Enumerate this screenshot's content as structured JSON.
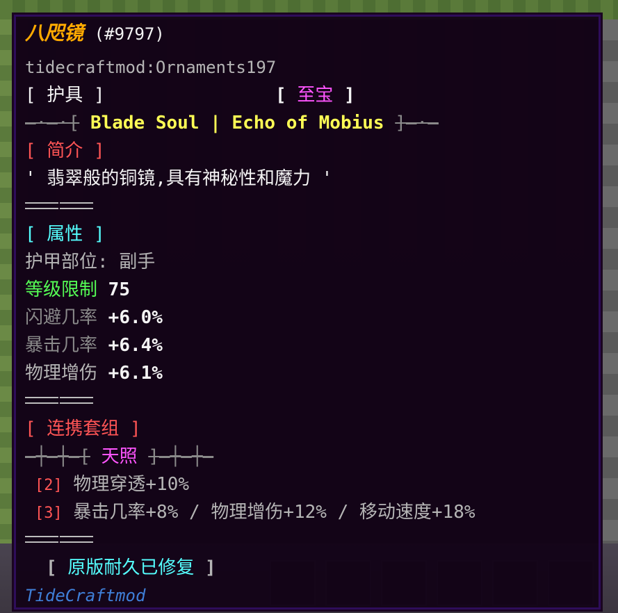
{
  "item": {
    "name": "八咫镜",
    "id": "(#9797)",
    "registry": "tidecraftmod:Ornaments197",
    "type_tag": "[ 护具 ]",
    "rarity_open": "[",
    "rarity": "至宝",
    "rarity_close": "]",
    "series_left": "—·—·[",
    "series": "Blade Soul | Echo of Mobius",
    "series_right": "]—·—",
    "intro_header": "[ 简介 ]",
    "description": "' 翡翠般的铜镜,具有神秘性和魔力 '",
    "attr_header": "[ 属性 ]",
    "slot_label": "护甲部位: 副手",
    "level_label": "等级限制",
    "level_value": "75",
    "stats": [
      {
        "label": "闪避几率",
        "value": "+6.0%"
      },
      {
        "label": "暴击几率",
        "value": "+6.4%"
      },
      {
        "label": "物理增伤",
        "value": "+6.1%"
      }
    ],
    "set_header": "[ 连携套组 ]",
    "set_left": "—┼—┼—[",
    "set_name": "天照",
    "set_right": "]—┼—┼—",
    "set_bonus": [
      {
        "count": "[2]",
        "text": "物理穿透+10%"
      },
      {
        "count": "[3]",
        "text": "暴击几率+8% / 物理增伤+12% / 移动速度+18%"
      }
    ],
    "repair_open": "[",
    "repair": "原版耐久已修复",
    "repair_close": "]",
    "mod": "TideCraftmod"
  },
  "colors": {
    "name": "#ffaa00",
    "rarity": "#ff55ff",
    "series": "#ffff55",
    "header_red": "#ff5555",
    "header_aqua": "#55ffff",
    "level": "#55ff55",
    "mod": "#3f7fd8"
  }
}
